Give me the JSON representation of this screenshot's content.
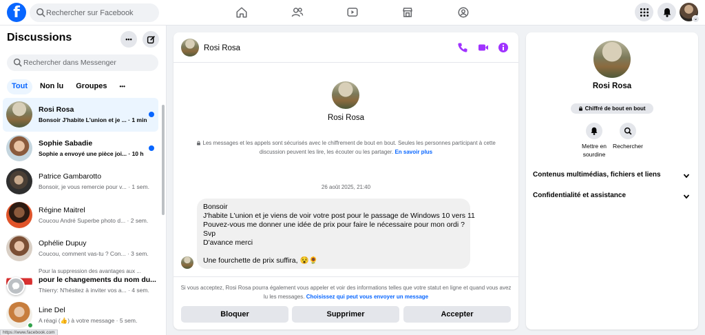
{
  "topbar": {
    "logo": "f",
    "search_placeholder": "Rechercher sur Facebook",
    "nav_icons": [
      "home-icon",
      "friends-icon",
      "video-icon",
      "marketplace-icon",
      "groups-icon"
    ],
    "profile_caret": "⌄"
  },
  "sidebar": {
    "title": "Discussions",
    "more_label": "•••",
    "search_placeholder": "Rechercher dans Messenger",
    "filters": [
      {
        "label": "Tout",
        "active": true
      },
      {
        "label": "Non lu",
        "active": false
      },
      {
        "label": "Groupes",
        "active": false
      },
      {
        "label": "•••",
        "active": false
      }
    ],
    "conversations": [
      {
        "name": "Rosi Rosa",
        "preview": "Bonsoir J'habite L'union et je ... · 1 min",
        "unread": true
      },
      {
        "name": "Sophie Sabadie",
        "preview": "Sophie a envoyé une pièce joi... · 10 h",
        "unread": true
      },
      {
        "name": "Patrice Gambarotto",
        "preview": "Bonsoir, je vous remercie pour v... · 1 sem.",
        "unread": false
      },
      {
        "name": "Régine Maitrel",
        "preview": "Coucou André Superbe photo d... · 2 sem.",
        "unread": false
      },
      {
        "name": "Ophélie Dupuy",
        "preview": "Coucou, comment vas-tu ? Con... · 3 sem.",
        "unread": false
      },
      {
        "name_line1": "Pour la suppression des avantages aux ...",
        "name_line2": "pour le changements du nom du...",
        "preview": "Thierry: N'hésitez à inviter vos a... · 4 sem."
      },
      {
        "name": "Line Del",
        "preview": "A réagi (👍) à votre message · 5 sem.",
        "unread": false
      }
    ],
    "status_url": "https://www.facebook.com"
  },
  "chat": {
    "contact_name": "Rosi Rosa",
    "encryption_note": "Les messages et les appels sont sécurisés avec le chiffrement de bout en bout. Seules les personnes participant à cette discussion peuvent les lire, les écouter ou les partager.",
    "learn_more": "En savoir plus",
    "date": "26 août 2025, 21:40",
    "message_lines": [
      "Bonsoir",
      "J'habite L'union et je viens de voir  votre post pour le passage de Windows 10 vers 11",
      "Pouvez-vous me donner une idée de prix pour faire le nécessaire pour mon ordi ?",
      "Svp",
      "D'avance merci",
      "",
      "Une fourchette de prix suffira, 😵🌻"
    ],
    "request_note": "Si vous acceptez, Rosi Rosa pourra également vous appeler et voir des informations telles que votre statut en ligne et quand vous avez lu les messages.",
    "request_link": "Choisissez qui peut vous envoyer un message",
    "buttons": {
      "block": "Bloquer",
      "delete": "Supprimer",
      "accept": "Accepter"
    },
    "accent_color": "#a033ff"
  },
  "details": {
    "name": "Rosi Rosa",
    "encryption_badge": "Chiffré de bout en bout",
    "actions": [
      {
        "label": "Mettre en sourdine",
        "icon": "bell-icon"
      },
      {
        "label": "Rechercher",
        "icon": "search-icon"
      }
    ],
    "sections": [
      "Contenus multimédias, fichiers et liens",
      "Confidentialité et assistance"
    ]
  }
}
